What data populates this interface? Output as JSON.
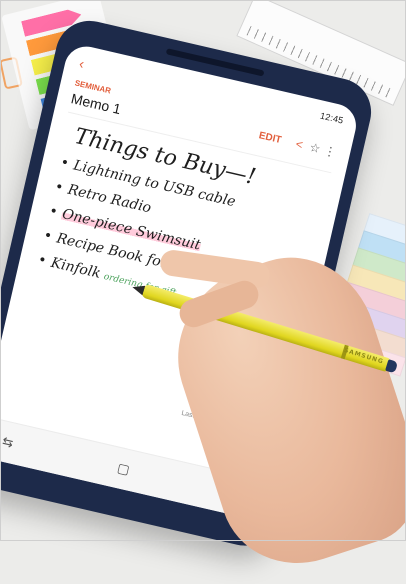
{
  "memo": {
    "category": "SEMINAR",
    "title": "Memo 1",
    "edit_label": "EDIT",
    "status_time": "12:45",
    "note_title": "Things to Buy—!",
    "items": [
      {
        "text": "Lightning to USB cable"
      },
      {
        "text": "Retro Radio"
      },
      {
        "text": "One-piece Swimsuit"
      },
      {
        "text": "Recipe Book for mother"
      },
      {
        "text": "Kinfolk",
        "extra": "ordering for gift"
      }
    ],
    "last_modified": "Last modified : May 18, 2017"
  },
  "pen": {
    "brand": "SAMSUNG"
  },
  "icons": {
    "back": "back-arrow-icon",
    "share": "share-icon",
    "star": "star-icon",
    "more": "more-vertical-icon",
    "nav_recent": "recent-apps-icon",
    "nav_home": "home-icon",
    "nav_back": "nav-back-icon"
  },
  "colors": {
    "accent": "#e2603e",
    "phone_body": "#1d2a4a",
    "pen": "#e0d61f",
    "highlight": "#ffa0be",
    "background": "#ececea"
  }
}
